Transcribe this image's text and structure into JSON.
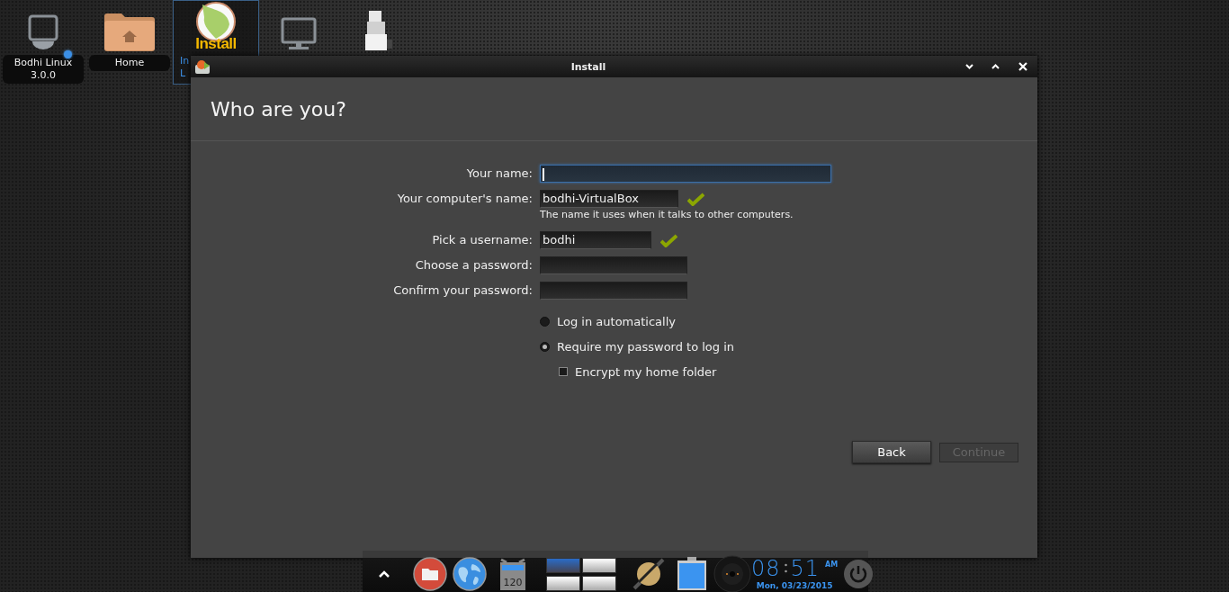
{
  "desktop_icons": [
    {
      "kind": "drive",
      "label_lines": [
        "Bodhi Linux",
        "3.0.0"
      ],
      "notification": true,
      "selected": false
    },
    {
      "kind": "folder",
      "label_lines": [
        "Home"
      ],
      "notification": false,
      "selected": false
    },
    {
      "kind": "install",
      "logo_text": "Install",
      "label_lines": [
        "In",
        "L"
      ],
      "notification": false,
      "selected": true
    },
    {
      "kind": "monitor",
      "notification": false,
      "selected": false
    },
    {
      "kind": "boxes",
      "notification": false,
      "selected": false
    }
  ],
  "window": {
    "title": "Install",
    "heading": "Who are you?",
    "fields": [
      {
        "label": "Your name:",
        "focused": true,
        "valid": false
      },
      {
        "label": "Your computer's name:",
        "value": "bodhi-VirtualBox",
        "focused": false,
        "valid": true,
        "hint": "The name it uses when it talks to other computers."
      },
      {
        "label": "Pick a username:",
        "value": "bodhi",
        "focused": false,
        "valid": true
      },
      {
        "label": "Choose a password:",
        "focused": false,
        "valid": false
      },
      {
        "label": "Confirm your password:",
        "focused": false,
        "valid": false
      }
    ],
    "login_options": [
      {
        "label": "Log in automatically",
        "selected": false
      },
      {
        "label": "Require my password to log in",
        "selected": true
      }
    ],
    "encrypt": {
      "label": "Encrypt my home folder",
      "checked": false
    },
    "buttons": [
      {
        "label": "Back",
        "disabled": false
      },
      {
        "label": "Continue",
        "disabled": true
      }
    ]
  },
  "taskbar": {
    "items": [
      {
        "kind": "up"
      },
      {
        "kind": "files"
      },
      {
        "kind": "globe"
      },
      {
        "kind": "meter",
        "text": "120"
      },
      {
        "kind": "pager",
        "desks": [
          {
            "selected": true
          },
          {
            "selected": false
          },
          {
            "selected": false
          },
          {
            "selected": false
          }
        ]
      },
      {
        "kind": "connector"
      },
      {
        "kind": "battery"
      },
      {
        "kind": "speaker"
      },
      {
        "kind": "clock",
        "hours": "08",
        "minutes": "51",
        "ampm": "AM",
        "date": "Mon, 03/23/2015"
      },
      {
        "kind": "power"
      }
    ]
  }
}
